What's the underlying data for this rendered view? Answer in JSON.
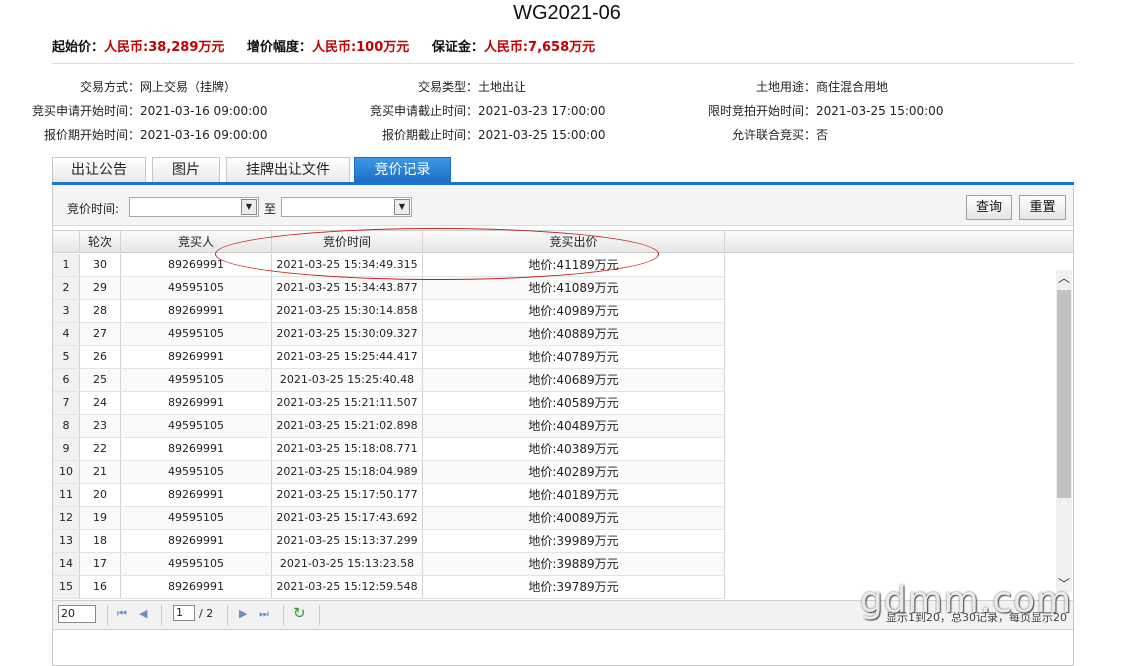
{
  "page_title": "WG2021-06",
  "price_line": [
    {
      "label": "起始价：",
      "value": "人民币:38,289万元"
    },
    {
      "label": "增价幅度：",
      "value": "人民币:100万元"
    },
    {
      "label": "保证金：",
      "value": "人民币:7,658万元"
    }
  ],
  "info": [
    [
      {
        "label": "交易方式：",
        "value": "网上交易（挂牌）"
      },
      {
        "label": "交易类型：",
        "value": "土地出让"
      },
      {
        "label": "土地用途：",
        "value": "商住混合用地"
      }
    ],
    [
      {
        "label": "竞买申请开始时间：",
        "value": "2021-03-16 09:00:00"
      },
      {
        "label": "竞买申请截止时间：",
        "value": "2021-03-23 17:00:00"
      },
      {
        "label": "限时竞拍开始时间：",
        "value": "2021-03-25 15:00:00"
      }
    ],
    [
      {
        "label": "报价期开始时间：",
        "value": "2021-03-16 09:00:00"
      },
      {
        "label": "报价期截止时间：",
        "value": "2021-03-25 15:00:00"
      },
      {
        "label": "允许联合竞买：",
        "value": "否"
      }
    ]
  ],
  "tabs": [
    {
      "label": "出让公告",
      "active": false
    },
    {
      "label": "图片",
      "active": false
    },
    {
      "label": "挂牌出让文件",
      "active": false
    },
    {
      "label": "竞价记录",
      "active": true
    }
  ],
  "filter": {
    "label": "竞价时间:",
    "to_label": "至",
    "search_button": "查询",
    "reset_button": "重置"
  },
  "table": {
    "headers": [
      "",
      "轮次",
      "竞买人",
      "竞价时间",
      "竞买出价"
    ],
    "rows": [
      [
        "1",
        "30",
        "89269991",
        "2021-03-25 15:34:49.315",
        "地价:41189万元"
      ],
      [
        "2",
        "29",
        "49595105",
        "2021-03-25 15:34:43.877",
        "地价:41089万元"
      ],
      [
        "3",
        "28",
        "89269991",
        "2021-03-25 15:30:14.858",
        "地价:40989万元"
      ],
      [
        "4",
        "27",
        "49595105",
        "2021-03-25 15:30:09.327",
        "地价:40889万元"
      ],
      [
        "5",
        "26",
        "89269991",
        "2021-03-25 15:25:44.417",
        "地价:40789万元"
      ],
      [
        "6",
        "25",
        "49595105",
        "2021-03-25 15:25:40.48",
        "地价:40689万元"
      ],
      [
        "7",
        "24",
        "89269991",
        "2021-03-25 15:21:11.507",
        "地价:40589万元"
      ],
      [
        "8",
        "23",
        "49595105",
        "2021-03-25 15:21:02.898",
        "地价:40489万元"
      ],
      [
        "9",
        "22",
        "89269991",
        "2021-03-25 15:18:08.771",
        "地价:40389万元"
      ],
      [
        "10",
        "21",
        "49595105",
        "2021-03-25 15:18:04.989",
        "地价:40289万元"
      ],
      [
        "11",
        "20",
        "89269991",
        "2021-03-25 15:17:50.177",
        "地价:40189万元"
      ],
      [
        "12",
        "19",
        "49595105",
        "2021-03-25 15:17:43.692",
        "地价:40089万元"
      ],
      [
        "13",
        "18",
        "89269991",
        "2021-03-25 15:13:37.299",
        "地价:39989万元"
      ],
      [
        "14",
        "17",
        "49595105",
        "2021-03-25 15:13:23.58",
        "地价:39889万元"
      ],
      [
        "15",
        "16",
        "89269991",
        "2021-03-25 15:12:59.548",
        "地价:39789万元"
      ]
    ]
  },
  "pager": {
    "page_size": "20",
    "current_page": "1",
    "total_pages": "/ 2",
    "info": "显示1到20，总30记录，每页显示20"
  },
  "watermark": "gdmm.com",
  "colors": {
    "accent": "#1874cd",
    "price_red": "#c00000",
    "highlight_ellipse": "#c81e1e"
  }
}
